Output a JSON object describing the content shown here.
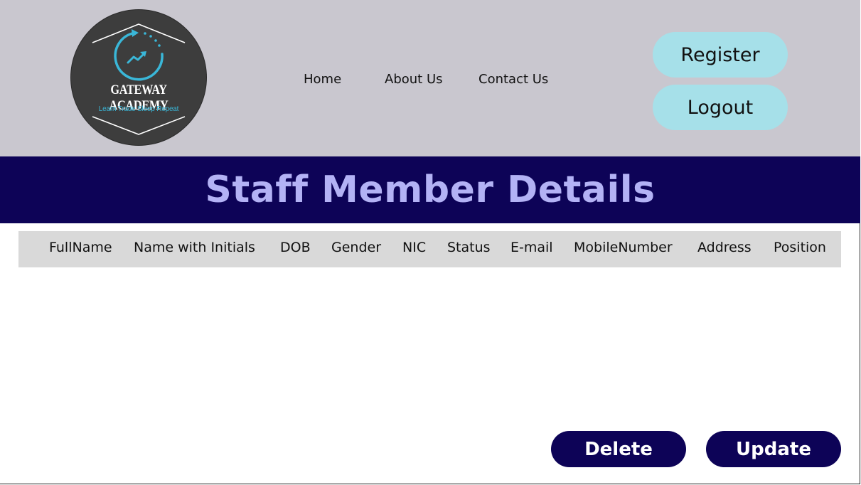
{
  "brand": {
    "name": "GATEWAY ACADEMY",
    "tagline": "Learn Trade Sleep Repeat",
    "logo_icon": "chart-arrow-circle-icon"
  },
  "nav": {
    "home": "Home",
    "about": "About Us",
    "contact": "Contact Us"
  },
  "auth": {
    "register": "Register",
    "logout": "Logout"
  },
  "page_title": "Staff Member Details",
  "table": {
    "columns": [
      "FullName",
      "Name with Initials",
      "DOB",
      "Gender",
      "NIC",
      "Status",
      "E-mail",
      "MobileNumber",
      "Address",
      "Position"
    ],
    "rows": []
  },
  "actions": {
    "delete": "Delete",
    "update": "Update"
  },
  "colors": {
    "header_bg": "#c9c7cf",
    "banner_bg": "#0d0357",
    "title_text": "#b3b2f5",
    "pill_bg": "#a6e0e9",
    "action_bg": "#0d0357",
    "table_head_bg": "#d9d9d9"
  }
}
